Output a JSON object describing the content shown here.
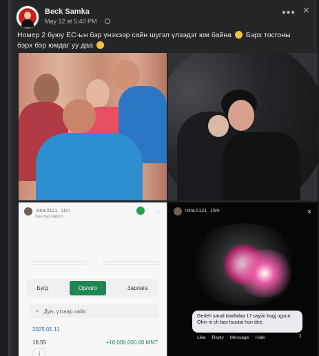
{
  "post": {
    "author": "Beck Samka",
    "time": "May 12 at 5:40 PM",
    "privacy": "·",
    "caption_1": "Номер 2 буюу ЕС-ын бэр үнэхээр сайн шугэл үлээдэг юм байна",
    "caption_2": "Бэрх тосгоны бэрх бэр юмдаг уу даа"
  },
  "photos": {
    "bank_user": "mira.0121",
    "bank_time": "11m",
    "bank_sub": "See translation",
    "tab_1": "Бүгд",
    "tab_2": "Орлого",
    "tab_3": "Зарлага",
    "search_placeholder": "Дүн, утгаар хайх",
    "date": "2025.01.11",
    "tx_time": "16:55",
    "tx_amount": "+10,000,000.00 MNT",
    "story_user": "mira.0121",
    "story_time": "15m",
    "comment": "Gerleh sanal tawihdaa 17 sayiin bugj ugsun. Ohin ni ch bas tsuutai hun dee.",
    "comment_actions": [
      "Like",
      "Reply",
      "Message",
      "Hide"
    ],
    "reaction_count": "1"
  },
  "colors": {
    "accent": "#1e8750",
    "link": "#2168b5"
  }
}
